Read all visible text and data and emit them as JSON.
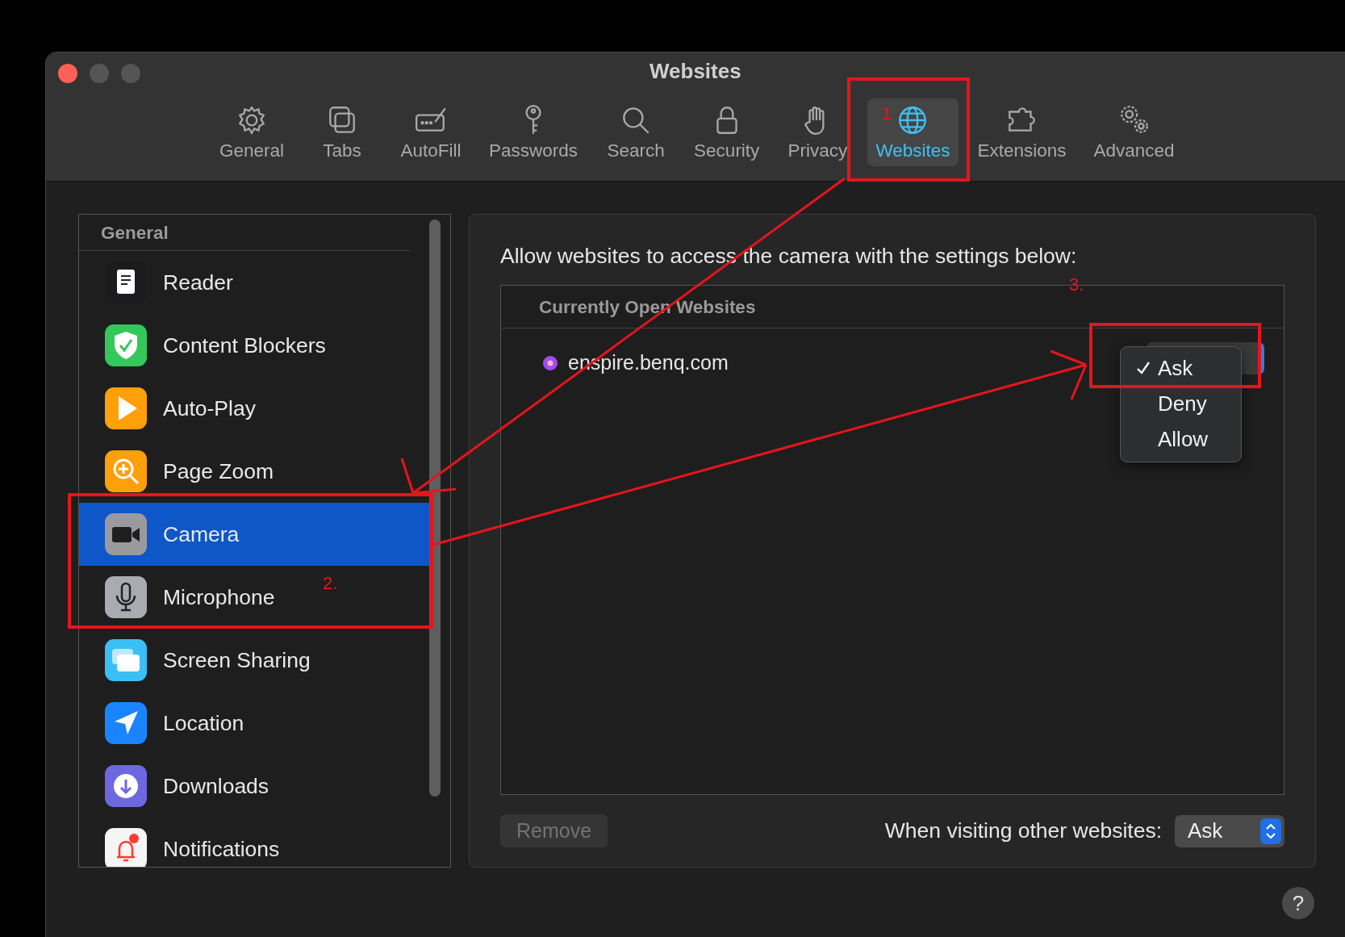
{
  "window": {
    "title": "Websites"
  },
  "toolbar": [
    {
      "label": "General",
      "selected": false
    },
    {
      "label": "Tabs",
      "selected": false
    },
    {
      "label": "AutoFill",
      "selected": false
    },
    {
      "label": "Passwords",
      "selected": false
    },
    {
      "label": "Search",
      "selected": false
    },
    {
      "label": "Security",
      "selected": false
    },
    {
      "label": "Privacy",
      "selected": false
    },
    {
      "label": "Websites",
      "selected": true
    },
    {
      "label": "Extensions",
      "selected": false
    },
    {
      "label": "Advanced",
      "selected": false
    }
  ],
  "sidebar": {
    "section": "General",
    "items": [
      {
        "label": "Reader",
        "selected": false
      },
      {
        "label": "Content Blockers",
        "selected": false
      },
      {
        "label": "Auto-Play",
        "selected": false
      },
      {
        "label": "Page Zoom",
        "selected": false
      },
      {
        "label": "Camera",
        "selected": true
      },
      {
        "label": "Microphone",
        "selected": false
      },
      {
        "label": "Screen Sharing",
        "selected": false
      },
      {
        "label": "Location",
        "selected": false
      },
      {
        "label": "Downloads",
        "selected": false
      },
      {
        "label": "Notifications",
        "selected": false
      }
    ]
  },
  "panel": {
    "description": "Allow websites to access the camera with the settings below:",
    "list_header": "Currently Open Websites",
    "websites": [
      {
        "domain": "enspire.benq.com",
        "menu_options": [
          {
            "label": "Ask",
            "selected": true
          },
          {
            "label": "Deny",
            "selected": false
          },
          {
            "label": "Allow",
            "selected": false
          }
        ]
      }
    ],
    "remove_button": {
      "label": "Remove",
      "disabled": true
    },
    "default_label": "When visiting other websites:",
    "default_value": "Ask"
  },
  "help_button": {
    "label": "?"
  },
  "annotations": [
    {
      "label": "1"
    },
    {
      "label": "2."
    },
    {
      "label": "3."
    }
  ]
}
